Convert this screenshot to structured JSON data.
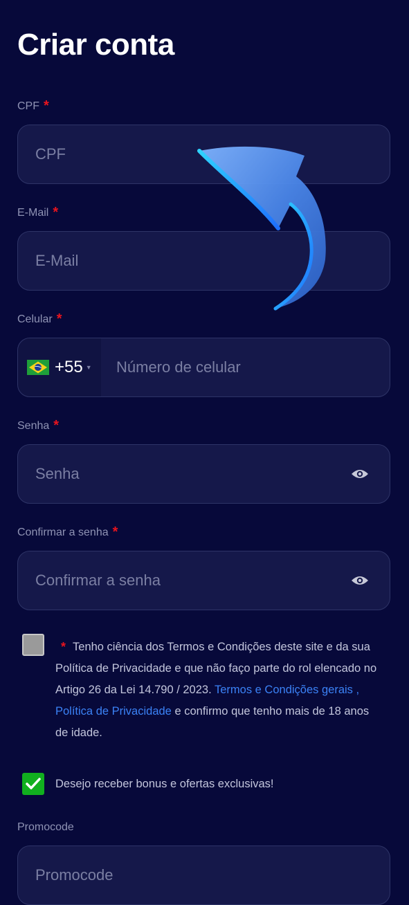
{
  "title": "Criar conta",
  "required_mark": "*",
  "fields": {
    "cpf": {
      "label": "CPF",
      "placeholder": "CPF"
    },
    "email": {
      "label": "E-Mail",
      "placeholder": "E-Mail"
    },
    "phone": {
      "label": "Celular",
      "placeholder": "Número de celular",
      "country_code": "+55",
      "country_flag": "brazil-flag-icon"
    },
    "password": {
      "label": "Senha",
      "placeholder": "Senha",
      "toggle_icon": "eye-icon"
    },
    "confirm_password": {
      "label": "Confirmar a senha",
      "placeholder": "Confirmar a senha",
      "toggle_icon": "eye-icon"
    },
    "promocode": {
      "label": "Promocode",
      "placeholder": "Promocode"
    }
  },
  "terms": {
    "checked": false,
    "text_before": "Tenho ciência dos Termos e Condições deste site e da sua Política de Privacidade e que não faço parte do rol elencado no Artigo 26 da Lei 14.790 / 2023.",
    "link_terms": "Termos e Condições gerais",
    "separator": ",",
    "link_privacy": "Política de Privacidade",
    "text_after": "e confirmo que tenho mais de 18 anos de idade."
  },
  "optin": {
    "checked": true,
    "text": "Desejo receber bonus e ofertas exclusivas!"
  },
  "colors": {
    "background": "#07093a",
    "field_background": "#15184a",
    "required": "#e8141e",
    "link": "#3b82f6",
    "checkbox_checked": "#11b01f",
    "arrow": "#3f9bff"
  },
  "overlay": {
    "icon": "curved-arrow-icon"
  }
}
